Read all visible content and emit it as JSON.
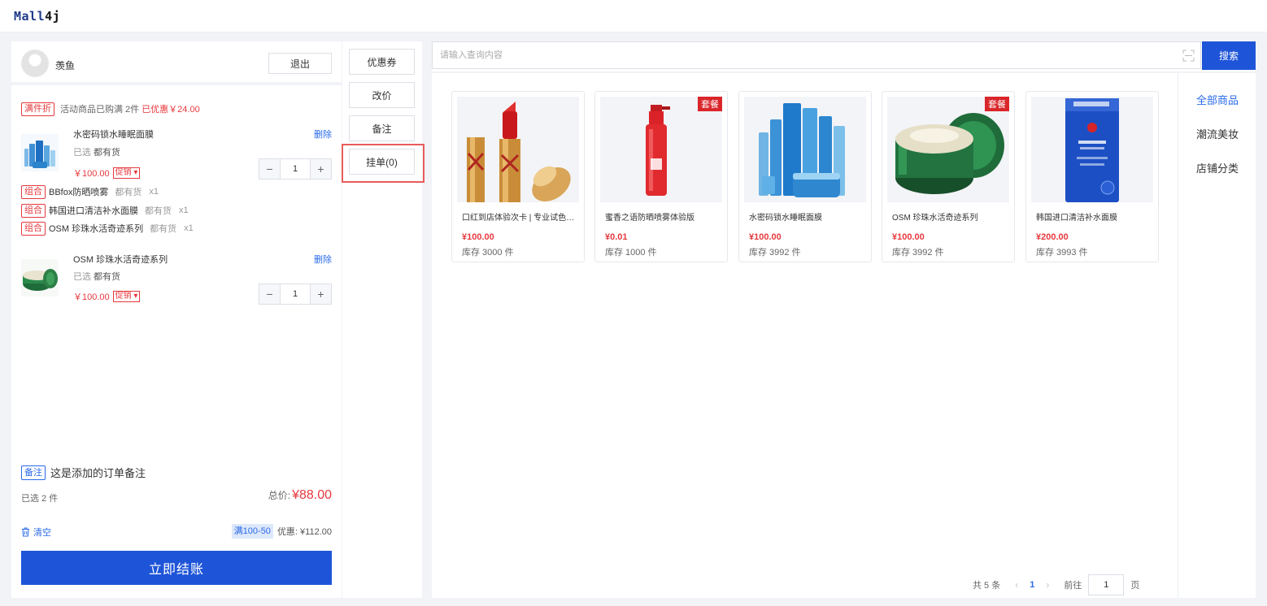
{
  "app": {
    "logo_prefix": "Mall",
    "logo_suffix": "4j"
  },
  "user": {
    "name": "羡鱼",
    "logout_label": "退出"
  },
  "cart": {
    "promo": {
      "tag": "满件折",
      "text": "活动商品已购满 2件",
      "saving": "已优惠￥24.00"
    },
    "items": [
      {
        "name": "水密码锁水睡眠面膜",
        "delete_label": "删除",
        "stock_label": "已选",
        "stock_value": "都有货",
        "price": "￥100.00",
        "promo_select": "促销 ▾",
        "qty": "1"
      },
      {
        "name": "OSM 珍珠水活奇迹系列",
        "delete_label": "删除",
        "stock_label": "已选",
        "stock_value": "都有货",
        "price": "￥100.00",
        "promo_select": "促销 ▾",
        "qty": "1"
      }
    ],
    "combos": [
      {
        "tag": "组合",
        "name": "BBfox防晒喷雾",
        "stock": "都有货",
        "qty": "x1"
      },
      {
        "tag": "组合",
        "name": "韩国进口清洁补水面膜",
        "stock": "都有货",
        "qty": "x1"
      },
      {
        "tag": "组合",
        "name": "OSM 珍珠水活奇迹系列",
        "stock": "都有货",
        "qty": "x1"
      }
    ],
    "remark_tag": "备注",
    "remark_text": "这是添加的订单备注",
    "selected_count": "已选 2 件",
    "total_label": "总价:",
    "total_value": "¥88.00",
    "clear_label": "清空",
    "discount_rule": "满100-50",
    "discount_text": "优惠: ¥112.00",
    "checkout_label": "立即结账"
  },
  "actions": {
    "coupon": "优惠券",
    "reprice": "改价",
    "remark": "备注",
    "hold": "挂单(0)"
  },
  "search": {
    "placeholder": "请输入查询内容",
    "button": "搜索"
  },
  "products": [
    {
      "name": "口红到店体验次卡 | 专业试色体验",
      "price": "¥100.00",
      "stock": "库存 3000 件",
      "tag": ""
    },
    {
      "name": "蜜香之语防晒喷雾体验版",
      "price": "¥0.01",
      "stock": "库存 1000 件",
      "tag": "套餐"
    },
    {
      "name": "水密码锁水睡眠面膜",
      "price": "¥100.00",
      "stock": "库存 3992 件",
      "tag": ""
    },
    {
      "name": "OSM 珍珠水活奇迹系列",
      "price": "¥100.00",
      "stock": "库存 3992 件",
      "tag": "套餐"
    },
    {
      "name": "韩国进口清洁补水面膜",
      "price": "¥200.00",
      "stock": "库存 3993 件",
      "tag": ""
    }
  ],
  "categories": [
    {
      "label": "全部商品",
      "active": true
    },
    {
      "label": "潮流美妆",
      "active": false
    },
    {
      "label": "店铺分类",
      "active": false
    }
  ],
  "pager": {
    "total": "共 5 条",
    "prev": "‹",
    "current": "1",
    "next": "›",
    "goto_label": "前往",
    "goto_value": "1",
    "page_suffix": "页"
  },
  "colors": {
    "primary": "#1e55d8",
    "link": "#2a6ae9",
    "price": "#e6393e",
    "highlight": "#e85c5c"
  }
}
